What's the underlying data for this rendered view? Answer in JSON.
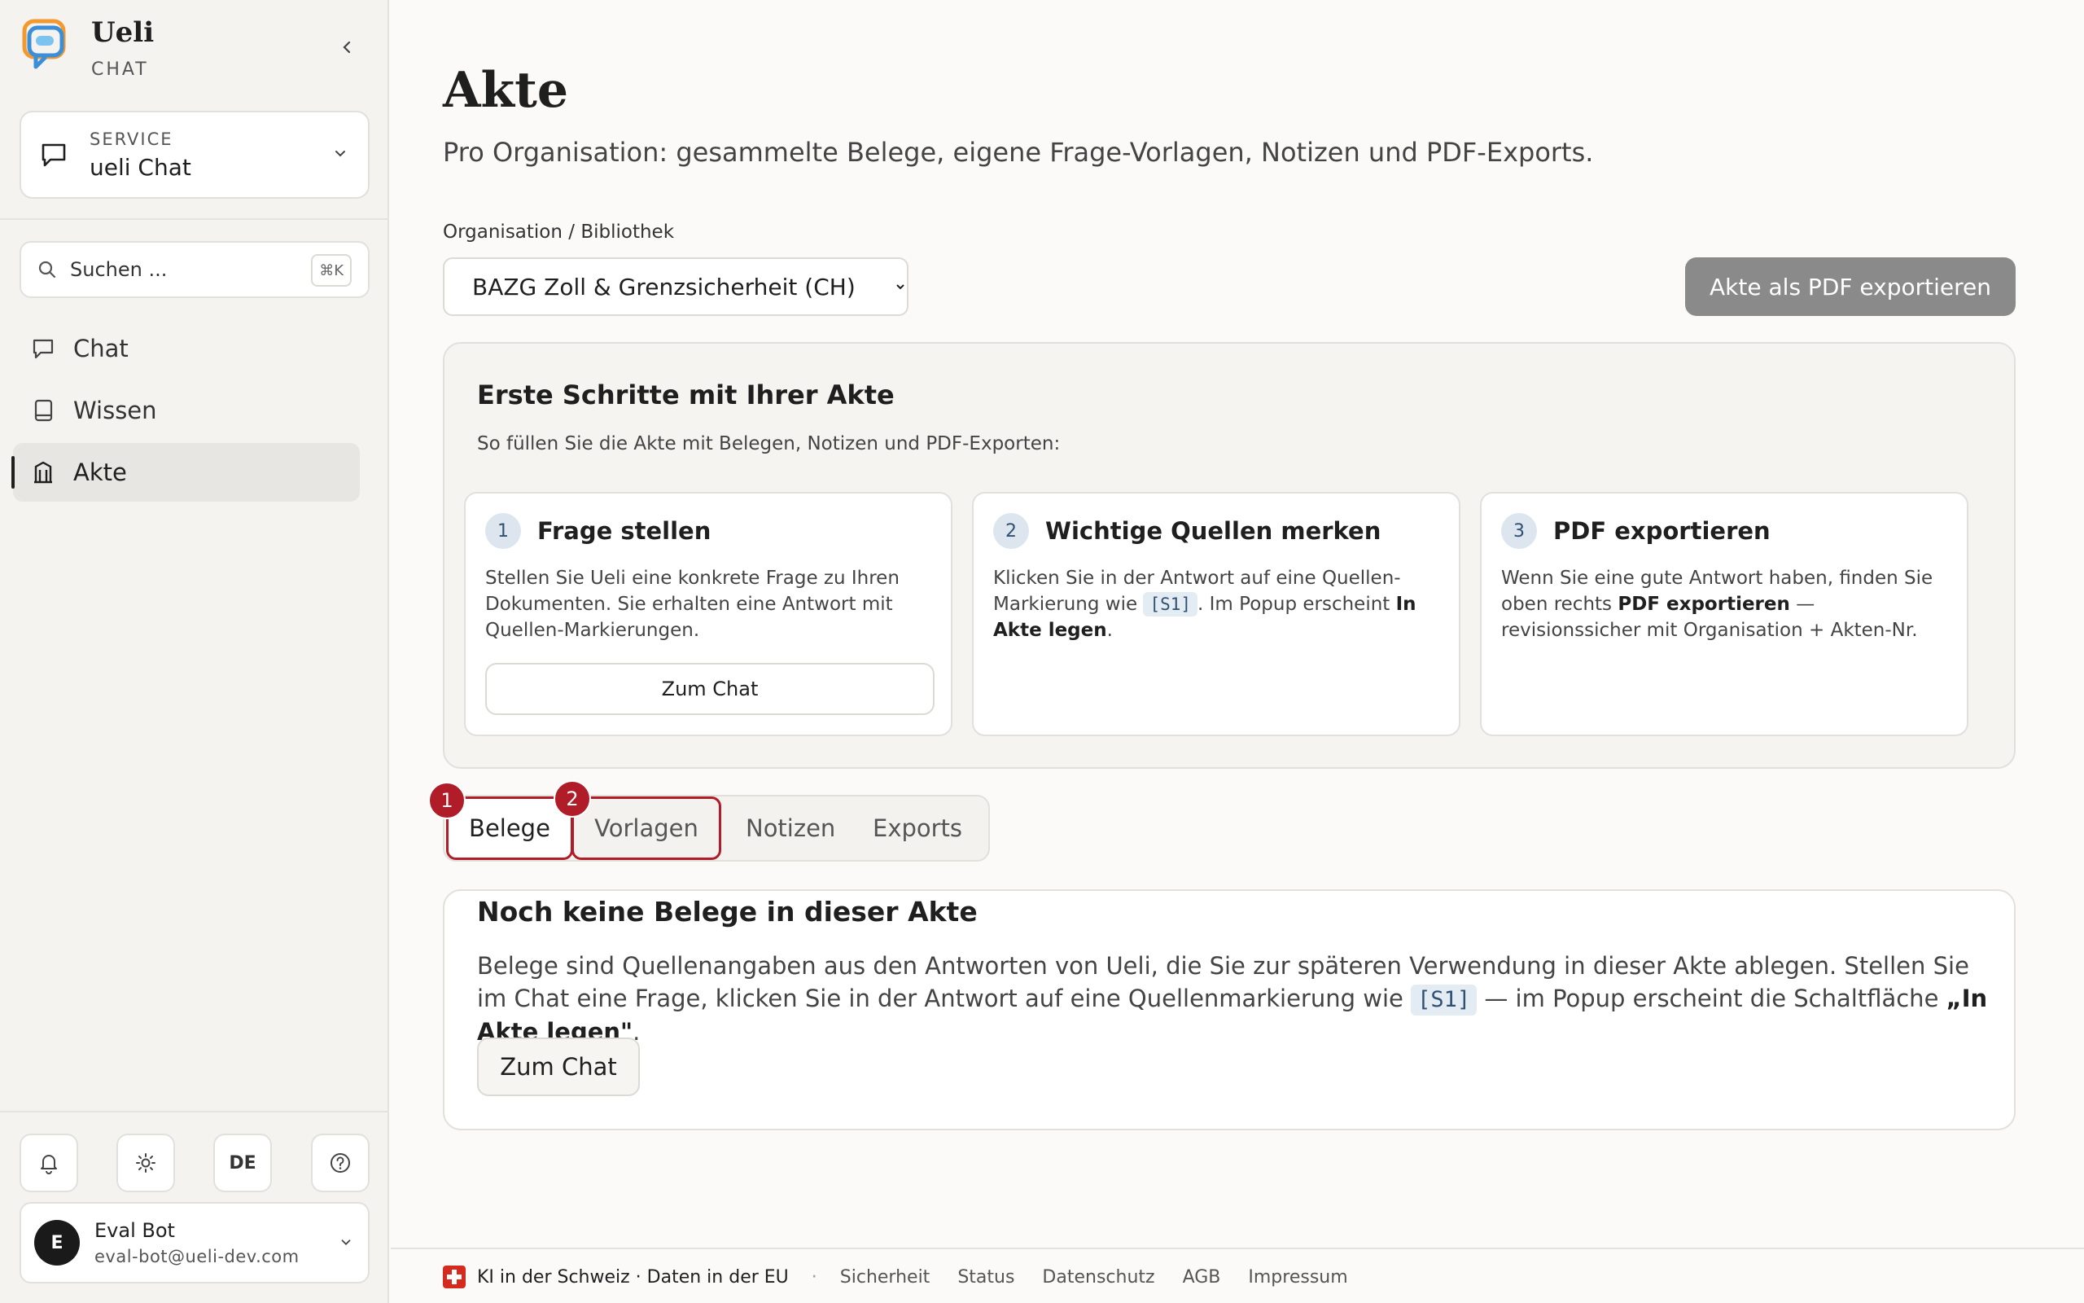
{
  "brand": {
    "name": "Ueli",
    "sub": "CHAT"
  },
  "service": {
    "label": "SERVICE",
    "value": "ueli Chat"
  },
  "search": {
    "placeholder": "Suchen ...",
    "shortcut": "⌘K"
  },
  "nav": {
    "items": [
      {
        "label": "Chat",
        "icon": "chat-icon"
      },
      {
        "label": "Wissen",
        "icon": "book-icon"
      },
      {
        "label": "Akte",
        "icon": "archive-icon",
        "active": true
      }
    ]
  },
  "utilities": {
    "language": "DE"
  },
  "user": {
    "initial": "E",
    "name": "Eval Bot",
    "email": "eval-bot@ueli-dev.com"
  },
  "page": {
    "title": "Akte",
    "subtitle": "Pro Organisation: gesammelte Belege, eigene Frage-Vorlagen, Notizen und PDF-Exports."
  },
  "org": {
    "label": "Organisation / Bibliothek",
    "selected": "BAZG Zoll & Grenzsicherheit (CH)"
  },
  "export_button": "Akte als PDF exportieren",
  "onboarding": {
    "title": "Erste Schritte mit Ihrer Akte",
    "subtitle": "So füllen Sie die Akte mit Belegen, Notizen und PDF-Exporten:",
    "steps": [
      {
        "num": "1",
        "title": "Frage stellen",
        "body": "Stellen Sie Ueli eine konkrete Frage zu Ihren Dokumenten. Sie erhalten eine Antwort mit Quellen-Markierungen.",
        "button": "Zum Chat"
      },
      {
        "num": "2",
        "title": "Wichtige Quellen merken",
        "body_pre": "Klicken Sie in der Antwort auf eine Quellen-Markierung wie",
        "chip": "[S1]",
        "body_mid": ". Im Popup erscheint",
        "body_bold": "In Akte legen",
        "body_post": "."
      },
      {
        "num": "3",
        "title": "PDF exportieren",
        "body_pre": "Wenn Sie eine gute Antwort haben, finden Sie oben rechts",
        "body_bold": "PDF exportieren",
        "body_post": "— revisionssicher mit Organisation + Akten-Nr."
      }
    ]
  },
  "tabs": [
    {
      "label": "Belege",
      "active": true,
      "marker": "1"
    },
    {
      "label": "Vorlagen",
      "marker": "2"
    },
    {
      "label": "Notizen"
    },
    {
      "label": "Exports"
    }
  ],
  "empty": {
    "title": "Noch keine Belege in dieser Akte",
    "body_pre": "Belege sind Quellenangaben aus den Antworten von Ueli, die Sie zur späteren Verwendung in dieser Akte ablegen. Stellen Sie im Chat eine Frage, klicken Sie in der Antwort auf eine Quellenmarkierung wie",
    "chip": "[S1]",
    "body_mid": "— im Popup erscheint die Schaltfläche",
    "body_bold": "„In Akte legen\"",
    "body_post": ".",
    "button": "Zum Chat"
  },
  "footer": {
    "claim": "KI in der Schweiz · Daten in der EU",
    "separator": "·",
    "links": [
      "Sicherheit",
      "Status",
      "Datenschutz",
      "AGB",
      "Impressum"
    ]
  },
  "colors": {
    "accent_red": "#b01c28",
    "swiss_red": "#d52b1e",
    "export_disabled": "#8a8a8a"
  }
}
